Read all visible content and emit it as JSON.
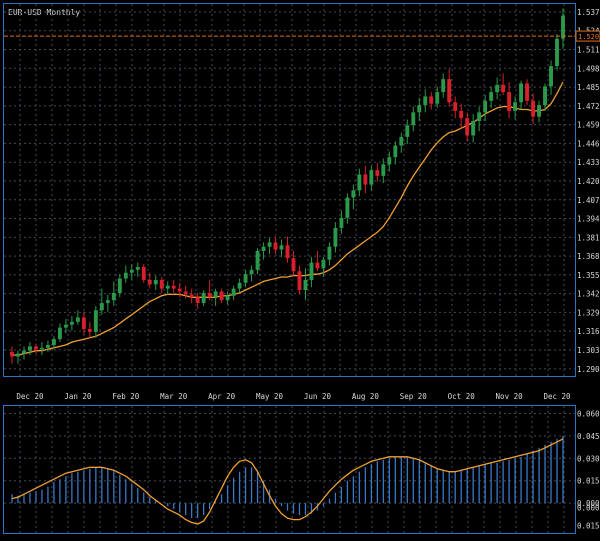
{
  "title": "EUR-USD Monthly",
  "price_tag": "1.5208",
  "colors": {
    "background": "#000000",
    "frame": "#2f74c0",
    "grid": "#3f4a58",
    "text": "#d8d8d8",
    "up": "#2a9a4a",
    "down": "#d8202c",
    "ma": "#f0a030",
    "price_line": "#e07020",
    "hist": "#3a78c8"
  },
  "chart_data": [
    {
      "type": "candlestick",
      "title": "EUR-USD Monthly",
      "ylim": [
        1.2855,
        1.543
      ],
      "y_ticks": [
        "1.5375",
        "1.5245",
        "1.5115",
        "1.4985",
        "1.4855",
        "1.4725",
        "1.4595",
        "1.4465",
        "1.4335",
        "1.4205",
        "1.4075",
        "1.3945",
        "1.3815",
        "1.3685",
        "1.3555",
        "1.3425",
        "1.3295",
        "1.3165",
        "1.3035",
        "1.2905"
      ],
      "x_ticks": [
        "Dec 20",
        "Jan 20",
        "Feb 20",
        "Mar 20",
        "Apr 20",
        "May 20",
        "Jun 20",
        "Aug 20",
        "Sep 20",
        "Oct 20",
        "Nov 20",
        "Dec 20"
      ],
      "x_tick_index": [
        3,
        11,
        19,
        27,
        35,
        43,
        51,
        59,
        67,
        75,
        83,
        91
      ],
      "current_price": 1.5208,
      "ohlc": [
        [
          1.302,
          1.306,
          1.294,
          1.299
        ],
        [
          1.299,
          1.303,
          1.294,
          1.301
        ],
        [
          1.301,
          1.306,
          1.297,
          1.303
        ],
        [
          1.303,
          1.309,
          1.3,
          1.306
        ],
        [
          1.306,
          1.308,
          1.301,
          1.304
        ],
        [
          1.304,
          1.309,
          1.3,
          1.305
        ],
        [
          1.305,
          1.31,
          1.302,
          1.307
        ],
        [
          1.307,
          1.313,
          1.304,
          1.311
        ],
        [
          1.311,
          1.322,
          1.309,
          1.319
        ],
        [
          1.319,
          1.325,
          1.315,
          1.321
        ],
        [
          1.321,
          1.327,
          1.317,
          1.323
        ],
        [
          1.323,
          1.331,
          1.321,
          1.326
        ],
        [
          1.326,
          1.33,
          1.314,
          1.318
        ],
        [
          1.318,
          1.323,
          1.312,
          1.316
        ],
        [
          1.316,
          1.334,
          1.312,
          1.331
        ],
        [
          1.331,
          1.346,
          1.328,
          1.336
        ],
        [
          1.336,
          1.342,
          1.33,
          1.338
        ],
        [
          1.338,
          1.351,
          1.334,
          1.343
        ],
        [
          1.343,
          1.356,
          1.34,
          1.353
        ],
        [
          1.353,
          1.362,
          1.35,
          1.357
        ],
        [
          1.357,
          1.363,
          1.352,
          1.359
        ],
        [
          1.359,
          1.364,
          1.354,
          1.361
        ],
        [
          1.361,
          1.363,
          1.35,
          1.352
        ],
        [
          1.352,
          1.357,
          1.346,
          1.349
        ],
        [
          1.349,
          1.355,
          1.345,
          1.352
        ],
        [
          1.352,
          1.354,
          1.343,
          1.346
        ],
        [
          1.346,
          1.351,
          1.342,
          1.348
        ],
        [
          1.348,
          1.352,
          1.343,
          1.346
        ],
        [
          1.346,
          1.35,
          1.34,
          1.344
        ],
        [
          1.344,
          1.348,
          1.339,
          1.342
        ],
        [
          1.342,
          1.346,
          1.336,
          1.34
        ],
        [
          1.34,
          1.343,
          1.332,
          1.336
        ],
        [
          1.336,
          1.345,
          1.334,
          1.343
        ],
        [
          1.343,
          1.352,
          1.338,
          1.34
        ],
        [
          1.34,
          1.346,
          1.334,
          1.344
        ],
        [
          1.344,
          1.346,
          1.336,
          1.338
        ],
        [
          1.338,
          1.344,
          1.335,
          1.341
        ],
        [
          1.341,
          1.348,
          1.338,
          1.346
        ],
        [
          1.346,
          1.353,
          1.343,
          1.35
        ],
        [
          1.35,
          1.359,
          1.347,
          1.356
        ],
        [
          1.356,
          1.362,
          1.351,
          1.359
        ],
        [
          1.359,
          1.374,
          1.356,
          1.372
        ],
        [
          1.372,
          1.378,
          1.366,
          1.375
        ],
        [
          1.375,
          1.381,
          1.37,
          1.378
        ],
        [
          1.378,
          1.382,
          1.37,
          1.373
        ],
        [
          1.373,
          1.38,
          1.368,
          1.376
        ],
        [
          1.376,
          1.382,
          1.364,
          1.367
        ],
        [
          1.367,
          1.372,
          1.355,
          1.358
        ],
        [
          1.358,
          1.362,
          1.342,
          1.345
        ],
        [
          1.345,
          1.36,
          1.338,
          1.352
        ],
        [
          1.352,
          1.368,
          1.347,
          1.364
        ],
        [
          1.364,
          1.372,
          1.358,
          1.36
        ],
        [
          1.36,
          1.368,
          1.354,
          1.366
        ],
        [
          1.366,
          1.378,
          1.362,
          1.375
        ],
        [
          1.375,
          1.392,
          1.371,
          1.388
        ],
        [
          1.388,
          1.4,
          1.384,
          1.395
        ],
        [
          1.395,
          1.412,
          1.391,
          1.409
        ],
        [
          1.409,
          1.418,
          1.401,
          1.414
        ],
        [
          1.414,
          1.429,
          1.41,
          1.425
        ],
        [
          1.425,
          1.431,
          1.412,
          1.418
        ],
        [
          1.418,
          1.431,
          1.414,
          1.428
        ],
        [
          1.428,
          1.433,
          1.42,
          1.424
        ],
        [
          1.424,
          1.436,
          1.419,
          1.432
        ],
        [
          1.432,
          1.441,
          1.427,
          1.437
        ],
        [
          1.437,
          1.448,
          1.432,
          1.445
        ],
        [
          1.445,
          1.454,
          1.44,
          1.451
        ],
        [
          1.451,
          1.463,
          1.446,
          1.459
        ],
        [
          1.459,
          1.472,
          1.455,
          1.468
        ],
        [
          1.468,
          1.478,
          1.462,
          1.473
        ],
        [
          1.473,
          1.484,
          1.468,
          1.479
        ],
        [
          1.479,
          1.482,
          1.47,
          1.474
        ],
        [
          1.474,
          1.486,
          1.471,
          1.482
        ],
        [
          1.482,
          1.495,
          1.478,
          1.491
        ],
        [
          1.491,
          1.498,
          1.472,
          1.475
        ],
        [
          1.475,
          1.479,
          1.464,
          1.469
        ],
        [
          1.469,
          1.474,
          1.457,
          1.464
        ],
        [
          1.464,
          1.468,
          1.448,
          1.452
        ],
        [
          1.452,
          1.467,
          1.447,
          1.462
        ],
        [
          1.462,
          1.472,
          1.455,
          1.468
        ],
        [
          1.468,
          1.48,
          1.462,
          1.476
        ],
        [
          1.476,
          1.486,
          1.471,
          1.482
        ],
        [
          1.482,
          1.492,
          1.477,
          1.487
        ],
        [
          1.487,
          1.495,
          1.48,
          1.482
        ],
        [
          1.482,
          1.489,
          1.464,
          1.469
        ],
        [
          1.469,
          1.479,
          1.463,
          1.475
        ],
        [
          1.475,
          1.49,
          1.47,
          1.488
        ],
        [
          1.488,
          1.491,
          1.473,
          1.476
        ],
        [
          1.476,
          1.481,
          1.46,
          1.465
        ],
        [
          1.465,
          1.476,
          1.461,
          1.473
        ],
        [
          1.473,
          1.488,
          1.469,
          1.486
        ],
        [
          1.486,
          1.504,
          1.48,
          1.5
        ],
        [
          1.5,
          1.522,
          1.497,
          1.519
        ],
        [
          1.519,
          1.54,
          1.512,
          1.535
        ]
      ],
      "ma": [
        1.3,
        1.3,
        1.301,
        1.302,
        1.303,
        1.303,
        1.304,
        1.305,
        1.306,
        1.307,
        1.309,
        1.31,
        1.311,
        1.312,
        1.313,
        1.315,
        1.317,
        1.319,
        1.322,
        1.325,
        1.328,
        1.331,
        1.334,
        1.337,
        1.339,
        1.341,
        1.342,
        1.342,
        1.342,
        1.341,
        1.34,
        1.34,
        1.34,
        1.34,
        1.34,
        1.341,
        1.341,
        1.342,
        1.343,
        1.345,
        1.347,
        1.349,
        1.351,
        1.352,
        1.353,
        1.354,
        1.354,
        1.355,
        1.355,
        1.355,
        1.356,
        1.356,
        1.357,
        1.359,
        1.362,
        1.366,
        1.37,
        1.373,
        1.376,
        1.379,
        1.382,
        1.385,
        1.389,
        1.395,
        1.402,
        1.409,
        1.417,
        1.424,
        1.43,
        1.436,
        1.442,
        1.447,
        1.451,
        1.454,
        1.455,
        1.457,
        1.459,
        1.461,
        1.464,
        1.467,
        1.469,
        1.471,
        1.472,
        1.472,
        1.471,
        1.47,
        1.47,
        1.469,
        1.469,
        1.47,
        1.474,
        1.481,
        1.489
      ]
    },
    {
      "type": "bar",
      "title": "",
      "ylim": [
        -0.02,
        0.065
      ],
      "y_ticks": [
        "0.060",
        "0.045",
        "0.030",
        "0.015",
        "0.000",
        "0.000",
        "0.015"
      ],
      "values": [
        0.006,
        0.005,
        0.006,
        0.007,
        0.008,
        0.009,
        0.011,
        0.014,
        0.016,
        0.018,
        0.02,
        0.021,
        0.022,
        0.023,
        0.024,
        0.024,
        0.023,
        0.022,
        0.019,
        0.016,
        0.013,
        0.01,
        0.007,
        0.004,
        0.002,
        0.0,
        -0.002,
        -0.004,
        -0.006,
        -0.008,
        -0.01,
        -0.01,
        -0.008,
        -0.004,
        0.001,
        0.006,
        0.012,
        0.017,
        0.021,
        0.024,
        0.024,
        0.021,
        0.015,
        0.009,
        0.003,
        -0.002,
        -0.005,
        -0.007,
        -0.008,
        -0.008,
        -0.007,
        -0.005,
        -0.002,
        0.003,
        0.007,
        0.011,
        0.015,
        0.018,
        0.021,
        0.024,
        0.026,
        0.028,
        0.029,
        0.03,
        0.031,
        0.031,
        0.031,
        0.03,
        0.029,
        0.027,
        0.025,
        0.023,
        0.022,
        0.021,
        0.021,
        0.022,
        0.023,
        0.024,
        0.025,
        0.026,
        0.027,
        0.027,
        0.028,
        0.029,
        0.03,
        0.031,
        0.033,
        0.035,
        0.037,
        0.039,
        0.041,
        0.043,
        0.045
      ],
      "signal": [
        0.003,
        0.004,
        0.006,
        0.008,
        0.01,
        0.012,
        0.014,
        0.016,
        0.018,
        0.02,
        0.021,
        0.022,
        0.023,
        0.024,
        0.024,
        0.024,
        0.023,
        0.022,
        0.02,
        0.018,
        0.015,
        0.012,
        0.009,
        0.005,
        0.002,
        -0.001,
        -0.004,
        -0.006,
        -0.008,
        -0.011,
        -0.013,
        -0.014,
        -0.012,
        -0.006,
        0.002,
        0.01,
        0.018,
        0.024,
        0.028,
        0.029,
        0.027,
        0.021,
        0.013,
        0.005,
        -0.002,
        -0.007,
        -0.01,
        -0.011,
        -0.011,
        -0.009,
        -0.006,
        -0.002,
        0.003,
        0.008,
        0.012,
        0.016,
        0.019,
        0.022,
        0.024,
        0.026,
        0.028,
        0.029,
        0.03,
        0.031,
        0.031,
        0.031,
        0.031,
        0.03,
        0.029,
        0.027,
        0.025,
        0.023,
        0.022,
        0.021,
        0.021,
        0.022,
        0.023,
        0.024,
        0.025,
        0.026,
        0.027,
        0.028,
        0.029,
        0.03,
        0.031,
        0.032,
        0.033,
        0.034,
        0.035,
        0.037,
        0.039,
        0.041,
        0.043
      ]
    }
  ]
}
